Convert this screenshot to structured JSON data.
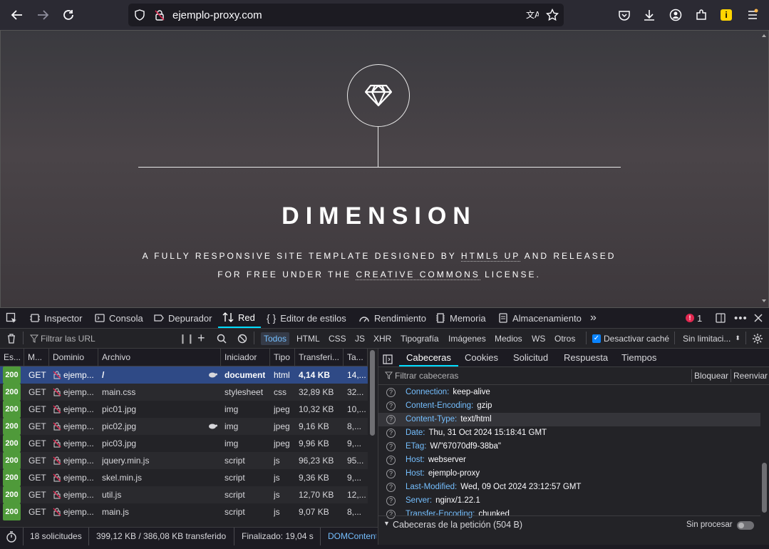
{
  "browser": {
    "url": "ejemplo-proxy.com",
    "nav_icons": [
      "back-arrow-icon",
      "forward-arrow-icon",
      "reload-icon"
    ],
    "right_icons": [
      "pocket-icon",
      "download-icon",
      "account-icon",
      "extensions-icon",
      "extension-badge-icon",
      "menu-icon"
    ]
  },
  "page": {
    "title": "DIMENSION",
    "subtitle_line1_a": "A FULLY RESPONSIVE SITE TEMPLATE DESIGNED BY ",
    "subtitle_line1_link": "HTML5 UP",
    "subtitle_line1_b": " AND RELEASED",
    "subtitle_line2_a": "FOR FREE UNDER THE ",
    "subtitle_line2_link": "CREATIVE COMMONS",
    "subtitle_line2_b": " LICENSE."
  },
  "devtools": {
    "tabs": [
      "Inspector",
      "Consola",
      "Depurador",
      "Red",
      "Editor de estilos",
      "Rendimiento",
      "Memoria",
      "Almacenamiento"
    ],
    "error_count": "1",
    "filter_placeholder": "Filtrar las URL",
    "type_filters": [
      "Todos",
      "HTML",
      "CSS",
      "JS",
      "XHR",
      "Tipografía",
      "Imágenes",
      "Medios",
      "WS",
      "Otros"
    ],
    "disable_cache_label": "Desactivar caché",
    "throttling": "Sin limitaci...",
    "columns": [
      "Es...",
      "M...",
      "Dominio",
      "Archivo",
      "Iniciador",
      "Tipo",
      "Transferi...",
      "Ta..."
    ],
    "rows": [
      {
        "status": "200",
        "method": "GET",
        "domain": "ejemp...",
        "file": "/",
        "initiator": "document",
        "type": "html",
        "transferred": "4,14 KB",
        "size": "14,..."
      },
      {
        "status": "200",
        "method": "GET",
        "domain": "ejemp...",
        "file": "main.css",
        "initiator": "stylesheet",
        "type": "css",
        "transferred": "32,89 KB",
        "size": "32..."
      },
      {
        "status": "200",
        "method": "GET",
        "domain": "ejemp...",
        "file": "pic01.jpg",
        "initiator": "img",
        "type": "jpeg",
        "transferred": "10,32 KB",
        "size": "10,..."
      },
      {
        "status": "200",
        "method": "GET",
        "domain": "ejemp...",
        "file": "pic02.jpg",
        "initiator": "img",
        "type": "jpeg",
        "transferred": "9,16 KB",
        "size": "8,..."
      },
      {
        "status": "200",
        "method": "GET",
        "domain": "ejemp...",
        "file": "pic03.jpg",
        "initiator": "img",
        "type": "jpeg",
        "transferred": "9,96 KB",
        "size": "9,..."
      },
      {
        "status": "200",
        "method": "GET",
        "domain": "ejemp...",
        "file": "jquery.min.js",
        "initiator": "script",
        "type": "js",
        "transferred": "96,23 KB",
        "size": "95..."
      },
      {
        "status": "200",
        "method": "GET",
        "domain": "ejemp...",
        "file": "skel.min.js",
        "initiator": "script",
        "type": "js",
        "transferred": "9,36 KB",
        "size": "9,..."
      },
      {
        "status": "200",
        "method": "GET",
        "domain": "ejemp...",
        "file": "util.js",
        "initiator": "script",
        "type": "js",
        "transferred": "12,70 KB",
        "size": "12,..."
      },
      {
        "status": "200",
        "method": "GET",
        "domain": "ejemp...",
        "file": "main.js",
        "initiator": "script",
        "type": "js",
        "transferred": "9,07 KB",
        "size": "8,..."
      }
    ],
    "status_bar": {
      "requests": "18 solicitudes",
      "transferred": "399,12 KB / 386,08 KB transferido",
      "finished": "Finalizado: 19,04 s",
      "dom": "DOMContent"
    },
    "panel": {
      "tabs": [
        "Cabeceras",
        "Cookies",
        "Solicitud",
        "Respuesta",
        "Tiempos"
      ],
      "filter_placeholder": "Filtrar cabeceras",
      "block_label": "Bloquear",
      "resend_label": "Reenviar",
      "headers": [
        {
          "name": "Connection:",
          "value": "keep-alive"
        },
        {
          "name": "Content-Encoding:",
          "value": "gzip"
        },
        {
          "name": "Content-Type:",
          "value": "text/html"
        },
        {
          "name": "Date:",
          "value": "Thu, 31 Oct 2024 15:18:41 GMT"
        },
        {
          "name": "ETag:",
          "value": "W/\"67070df9-38ba\""
        },
        {
          "name": "Host:",
          "value": "webserver"
        },
        {
          "name": "Host:",
          "value": "ejemplo-proxy"
        },
        {
          "name": "Last-Modified:",
          "value": "Wed, 09 Oct 2024 23:12:57 GMT"
        },
        {
          "name": "Server:",
          "value": "nginx/1.22.1"
        },
        {
          "name": "Transfer-Encoding:",
          "value": "chunked"
        }
      ],
      "request_headers_label": "Cabeceras de la petición (504 B)",
      "raw_label": "Sin procesar"
    }
  }
}
